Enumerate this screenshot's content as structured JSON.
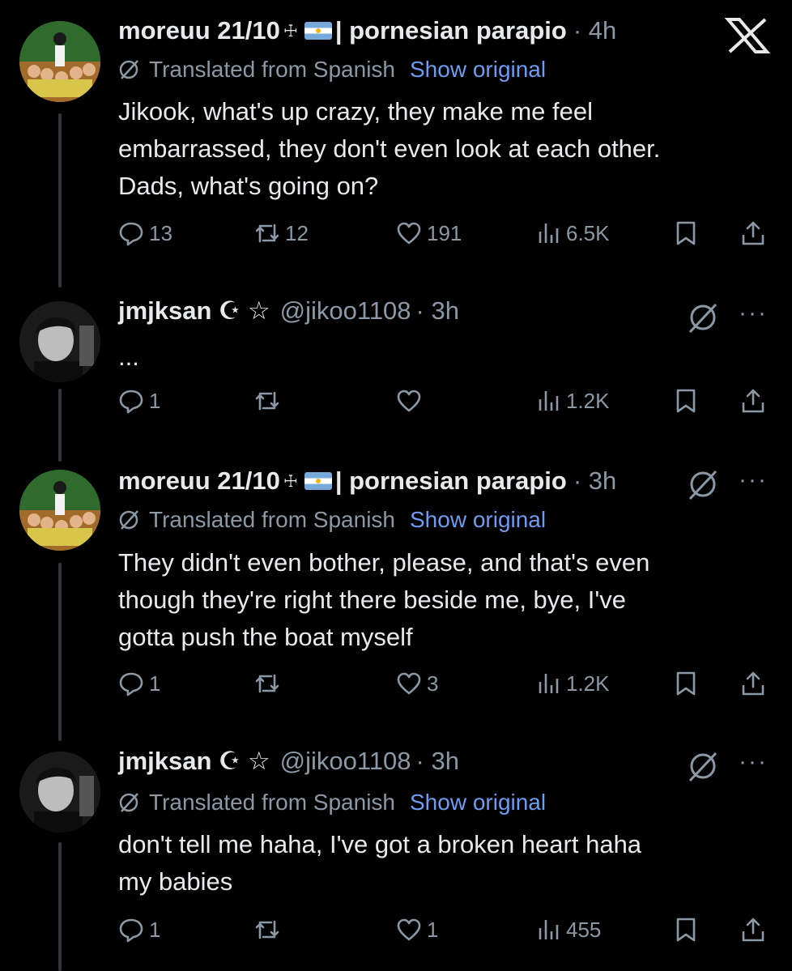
{
  "app": {
    "logo_icon": "x-logo-icon"
  },
  "translated_label": "Translated from Spanish",
  "show_original_label": "Show original",
  "more_label": "···",
  "tweets": [
    {
      "name": "moreuu 21/10",
      "cross": "☩",
      "flag": "argentina-flag-icon",
      "name_suffix": "| pornesian parapio",
      "handle": "",
      "time": "· 4h",
      "translated": true,
      "text_lines": [
        "Jikook, what's up crazy, they make me feel",
        "embarrassed, they don't even look at each other.",
        "Dads, what's going on?"
      ],
      "replies": "13",
      "reposts": "12",
      "likes": "191",
      "views": "6.5K"
    },
    {
      "name": "jmjksan",
      "name_suffix": "☪ ☆",
      "handle": "@jikoo1108",
      "time": "· 3h",
      "translated": false,
      "text_lines": [
        "..."
      ],
      "replies": "1",
      "reposts": "",
      "likes": "",
      "views": "1.2K"
    },
    {
      "name": "moreuu 21/10",
      "cross": "☩",
      "flag": "argentina-flag-icon",
      "name_suffix": "| pornesian parapio",
      "handle": "",
      "time": "· 3h",
      "translated": true,
      "text_lines": [
        "They didn't even bother, please, and that's even",
        "though they're right there beside me, bye, I've",
        "gotta push the boat myself"
      ],
      "replies": "1",
      "reposts": "",
      "likes": "3",
      "views": "1.2K"
    },
    {
      "name": "jmjksan",
      "name_suffix": "☪ ☆",
      "handle": "@jikoo1108",
      "time": "· 3h",
      "translated": true,
      "text_lines": [
        "don't tell me haha, I've got a broken heart haha",
        "my babies"
      ],
      "replies": "1",
      "reposts": "",
      "likes": "1",
      "views": "455"
    }
  ]
}
